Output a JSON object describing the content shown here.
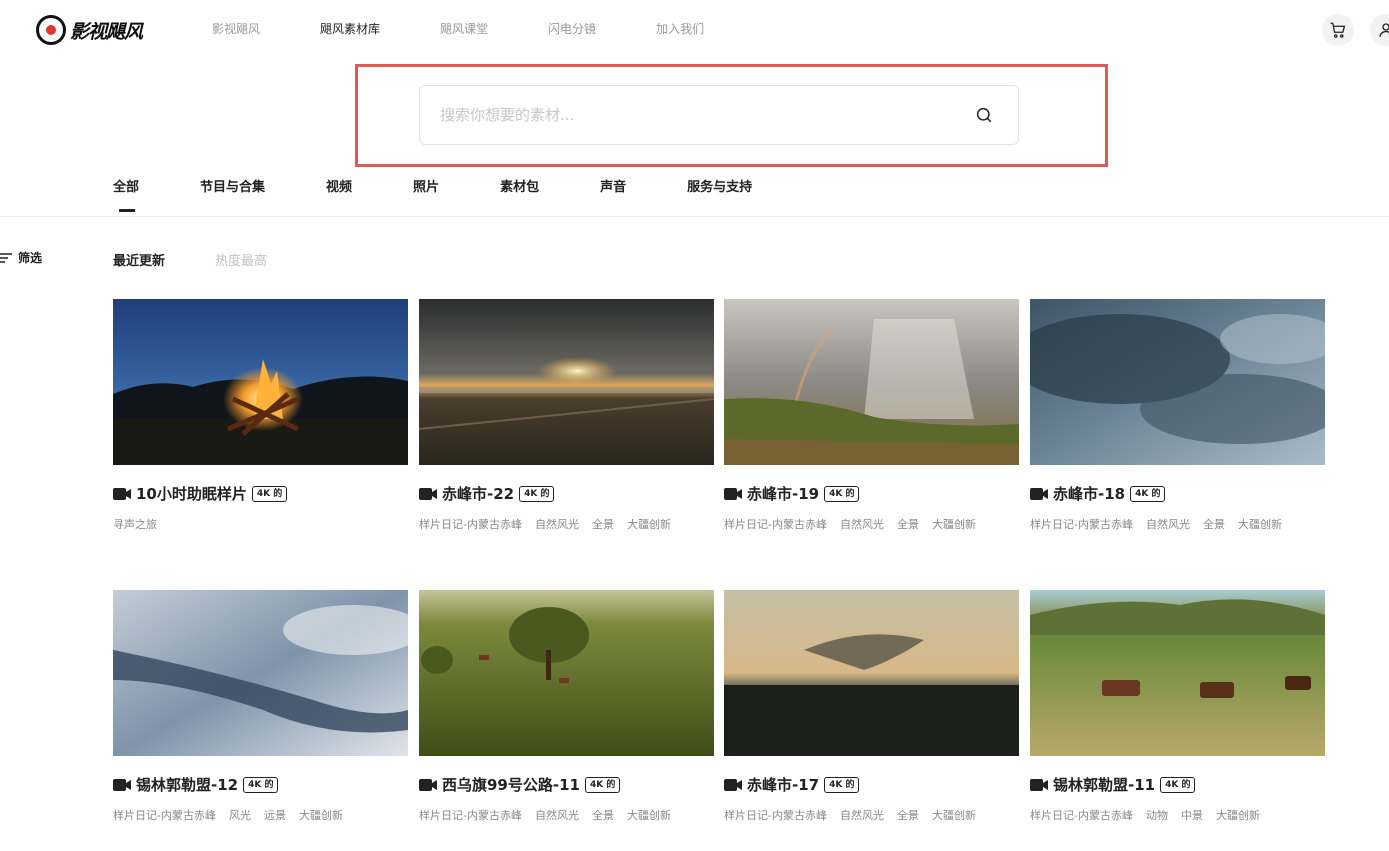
{
  "brand": {
    "name": "影视飓风"
  },
  "nav": {
    "items": [
      {
        "label": "影视飓风",
        "active": false
      },
      {
        "label": "飓风素材库",
        "active": true
      },
      {
        "label": "飓风课堂",
        "active": false
      },
      {
        "label": "闪电分镜",
        "active": false
      },
      {
        "label": "加入我们",
        "active": false
      }
    ]
  },
  "search": {
    "placeholder": "搜索你想要的素材...",
    "value": ""
  },
  "tabs": [
    {
      "label": "全部",
      "active": true
    },
    {
      "label": "节目与合集",
      "active": false
    },
    {
      "label": "视频",
      "active": false
    },
    {
      "label": "照片",
      "active": false
    },
    {
      "label": "素材包",
      "active": false
    },
    {
      "label": "声音",
      "active": false
    },
    {
      "label": "服务与支持",
      "active": false
    }
  ],
  "filter": {
    "label": "筛选"
  },
  "sort": [
    {
      "label": "最近更新",
      "active": true
    },
    {
      "label": "热度最高",
      "active": false
    }
  ],
  "cards": [
    {
      "title": "10小时助眠样片",
      "badge": "4K 的",
      "tags": [
        "寻声之旅"
      ]
    },
    {
      "title": "赤峰市-22",
      "badge": "4K 的",
      "tags": [
        "样片日记-内蒙古赤峰",
        "自然风光",
        "全景",
        "大疆创新"
      ]
    },
    {
      "title": "赤峰市-19",
      "badge": "4K 的",
      "tags": [
        "样片日记-内蒙古赤峰",
        "自然风光",
        "全景",
        "大疆创新"
      ]
    },
    {
      "title": "赤峰市-18",
      "badge": "4K 的",
      "tags": [
        "样片日记-内蒙古赤峰",
        "自然风光",
        "全景",
        "大疆创新"
      ]
    },
    {
      "title": "锡林郭勒盟-12",
      "badge": "4K 的",
      "tags": [
        "样片日记-内蒙古赤峰",
        "风光",
        "远景",
        "大疆创新"
      ]
    },
    {
      "title": "西乌旗99号公路-11",
      "badge": "4K 的",
      "tags": [
        "样片日记-内蒙古赤峰",
        "自然风光",
        "全景",
        "大疆创新"
      ]
    },
    {
      "title": "赤峰市-17",
      "badge": "4K 的",
      "tags": [
        "样片日记-内蒙古赤峰",
        "自然风光",
        "全景",
        "大疆创新"
      ]
    },
    {
      "title": "锡林郭勒盟-11",
      "badge": "4K 的",
      "tags": [
        "样片日记-内蒙古赤峰",
        "动物",
        "中景",
        "大疆创新"
      ]
    }
  ],
  "colors": {
    "highlight": "#e05a55",
    "text": "#222222",
    "muted": "#999999"
  }
}
